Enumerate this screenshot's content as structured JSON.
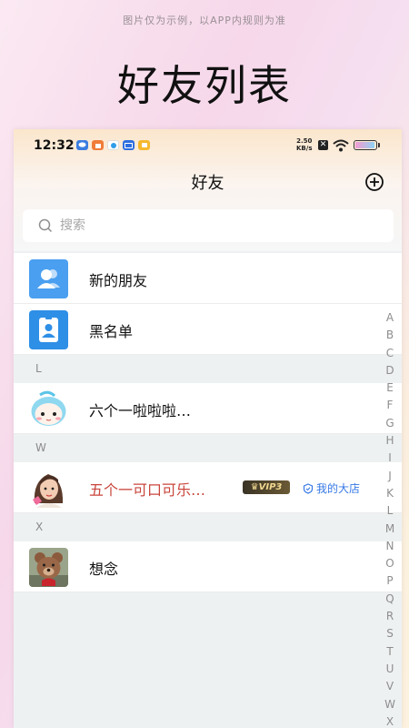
{
  "promo": {
    "disclaimer": "图片仅为示例，以APP内规则为准",
    "title": "好友列表"
  },
  "status_bar": {
    "time": "12:32",
    "net_speed_value": "2.50",
    "net_speed_unit": "KB/s",
    "battery_level": 0.95,
    "notification_icons": [
      "chat-app-icon",
      "store-app-icon",
      "map-app-icon",
      "mail-app-icon",
      "video-app-icon"
    ]
  },
  "nav": {
    "title": "好友",
    "add_icon": "plus-circle-icon"
  },
  "search": {
    "placeholder": "搜索"
  },
  "fixed_items": [
    {
      "label": "新的朋友",
      "icon": "new-friends-icon",
      "icon_color": "#4a9ff0"
    },
    {
      "label": "黑名单",
      "icon": "blacklist-icon",
      "icon_color": "#2e8fe6"
    }
  ],
  "sections": [
    {
      "letter": "L",
      "contacts": [
        {
          "name": "六个一啦啦啦…",
          "avatar": "cartoon-girl-avatar"
        }
      ]
    },
    {
      "letter": "W",
      "contacts": [
        {
          "name": "五个一可口可乐…",
          "avatar": "girl-photo-avatar",
          "vip_label": "VIP3",
          "shop_label": "我的大店"
        }
      ]
    },
    {
      "letter": "X",
      "contacts": [
        {
          "name": "想念",
          "avatar": "teddy-bear-avatar"
        }
      ]
    }
  ],
  "alphabet": [
    "A",
    "B",
    "C",
    "D",
    "E",
    "F",
    "G",
    "H",
    "I",
    "J",
    "K",
    "L",
    "M",
    "N",
    "O",
    "P",
    "Q",
    "R",
    "S",
    "T",
    "U",
    "V",
    "W",
    "X"
  ],
  "colors": {
    "vip_name": "#c9463d",
    "shop_link": "#3678e6",
    "page_bg": "#eef1f2"
  }
}
